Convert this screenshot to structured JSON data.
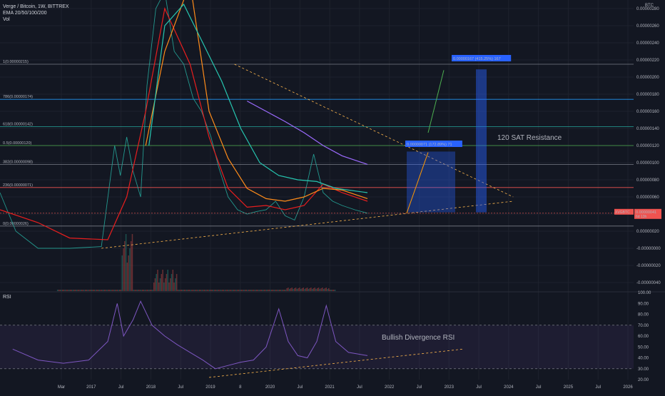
{
  "header": {
    "title": "Verge / Bitcoin, 1W, BITTREX",
    "indicator": "EMA 20/50/100/200",
    "volume": "Vol"
  },
  "price_unit": "BTC",
  "colors": {
    "background": "#131722",
    "grid": "#1e222d",
    "up": "#26a69a",
    "down": "#ef5350",
    "ema20": "#e91e1e",
    "ema50": "#ff8c1a",
    "ema100": "#26c6b0",
    "ema200": "#9c6bff",
    "rsi": "#7e57c2",
    "accent_blue": "#2962ff"
  },
  "chart_data": [
    {
      "type": "line",
      "title": "Verge / Bitcoin, 1W, BITTREX",
      "xlabel": "",
      "ylabel": "",
      "x_ticks": [
        "Mar",
        "2017",
        "Jul",
        "2018",
        "Jul",
        "2019",
        "8",
        "2020",
        "Jul",
        "2021",
        "Jul",
        "2022",
        "Jul",
        "2023",
        "Jul",
        "2024",
        "Jul",
        "2025",
        "Jul",
        "2026"
      ],
      "y_ticks": [
        "0.00000280",
        "0.00000260",
        "0.00000240",
        "0.00000220",
        "0.00000200",
        "0.00000180",
        "0.00000160",
        "0.00000140",
        "0.00000120",
        "0.00000100",
        "0.00000080",
        "0.00000060",
        "0.00000040",
        "0.00000020",
        "-0.00000000",
        "-0.00000020",
        "-0.00000040"
      ],
      "ylim": [
        -5e-07,
        2.9e-06
      ],
      "price_tag": {
        "symbol": "XVGBTC",
        "value": "0.00000041",
        "countdown": "6d 13h"
      },
      "fib_levels": [
        {
          "ratio": "1",
          "label": "1(0.00000215)",
          "price": 2.15e-06
        },
        {
          "ratio": "0.786",
          "label": "786(0.00000174)",
          "price": 1.74e-06
        },
        {
          "ratio": "0.618",
          "label": "618(0.00000142)",
          "price": 1.42e-06
        },
        {
          "ratio": "0.5",
          "label": "0.5(0.00000120)",
          "price": 1.2e-06
        },
        {
          "ratio": "0.382",
          "label": "382(0.00000098)",
          "price": 9.8e-07
        },
        {
          "ratio": "0.236",
          "label": "236(0.00000071)",
          "price": 7.1e-07
        },
        {
          "ratio": "0",
          "label": "0(0.00000026)",
          "price": 2.6e-07
        }
      ],
      "annotations": [
        {
          "text": "0.00000071 (172.89%) 71",
          "kind": "measure-label"
        },
        {
          "text": "0.00000167 (415.25%) 167",
          "kind": "measure-label"
        },
        {
          "text": "120 SAT Resistance",
          "kind": "note"
        }
      ],
      "series": [
        {
          "name": "Price",
          "x": [
            0.0,
            0.025,
            0.06,
            0.11,
            0.16,
            0.181,
            0.19,
            0.2,
            0.21,
            0.222,
            0.232,
            0.246,
            0.26,
            0.275,
            0.29,
            0.305,
            0.318,
            0.333,
            0.345,
            0.36,
            0.375,
            0.39,
            0.405,
            0.42,
            0.435,
            0.45,
            0.465,
            0.48,
            0.495,
            0.51,
            0.525,
            0.54,
            0.56,
            0.58
          ],
          "y": [
            6.5e-07,
            2e-07,
            0.0,
            0.0,
            2e-08,
            1.2e-06,
            8.5e-07,
            1.3e-06,
            9e-07,
            6e-07,
            1.9e-06,
            2.8e-06,
            3e-06,
            2.3e-06,
            2.15e-06,
            1.75e-06,
            1.6e-06,
            1.3e-06,
            9.5e-07,
            6e-07,
            4.5e-07,
            4e-07,
            4.3e-07,
            4.5e-07,
            5.5e-07,
            3.8e-07,
            3.3e-07,
            6e-07,
            1.1e-06,
            6.5e-07,
            5.5e-07,
            5e-07,
            4.5e-07,
            4.1e-07
          ]
        },
        {
          "name": "EMA 20",
          "x": [
            0.0,
            0.06,
            0.11,
            0.17,
            0.2,
            0.23,
            0.26,
            0.3,
            0.33,
            0.36,
            0.39,
            0.42,
            0.45,
            0.48,
            0.51,
            0.54,
            0.58
          ],
          "y": [
            4.5e-07,
            3e-07,
            1.2e-07,
            1e-07,
            6e-07,
            1.6e-06,
            2.8e-06,
            2.15e-06,
            1.3e-06,
            7e-07,
            4.8e-07,
            5e-07,
            4.5e-07,
            5e-07,
            7.5e-07,
            6.5e-07,
            5.5e-07
          ]
        },
        {
          "name": "EMA 50",
          "x": [
            0.23,
            0.26,
            0.3,
            0.33,
            0.36,
            0.39,
            0.42,
            0.45,
            0.48,
            0.51,
            0.54,
            0.58
          ],
          "y": [
            1.2e-06,
            2.3e-06,
            3.1e-06,
            1.6e-06,
            1.05e-06,
            7e-07,
            5.8e-07,
            5.5e-07,
            6e-07,
            7e-07,
            6.8e-07,
            5.8e-07
          ]
        },
        {
          "name": "EMA 100",
          "x": [
            0.235,
            0.26,
            0.29,
            0.32,
            0.35,
            0.38,
            0.41,
            0.44,
            0.47,
            0.5,
            0.53,
            0.58
          ],
          "y": [
            1.2e-06,
            2.6e-06,
            2.85e-06,
            2.4e-06,
            1.95e-06,
            1.4e-06,
            1e-06,
            8.5e-07,
            8e-07,
            7.8e-07,
            7e-07,
            6.5e-07
          ]
        },
        {
          "name": "EMA 200",
          "x": [
            0.39,
            0.42,
            0.45,
            0.48,
            0.51,
            0.54,
            0.58
          ],
          "y": [
            1.72e-06,
            1.6e-06,
            1.48e-06,
            1.35e-06,
            1.2e-06,
            1.08e-06,
            9.8e-07
          ]
        }
      ]
    },
    {
      "type": "line",
      "title": "RSI",
      "ylim": [
        20,
        100
      ],
      "y_ticks": [
        "100.00",
        "90.00",
        "80.00",
        "70.00",
        "60.00",
        "50.00",
        "40.00",
        "30.00",
        "20.00"
      ],
      "bands": {
        "upper": 70,
        "lower": 30
      },
      "annotations": [
        {
          "text": "Bullish Divergence RSI",
          "kind": "note"
        }
      ],
      "series": [
        {
          "name": "RSI",
          "x": [
            0.02,
            0.06,
            0.1,
            0.14,
            0.17,
            0.185,
            0.195,
            0.21,
            0.222,
            0.24,
            0.26,
            0.28,
            0.3,
            0.32,
            0.34,
            0.36,
            0.38,
            0.4,
            0.42,
            0.44,
            0.455,
            0.47,
            0.485,
            0.5,
            0.515,
            0.53,
            0.55,
            0.58
          ],
          "y": [
            48,
            38,
            35,
            38,
            55,
            90,
            60,
            75,
            92,
            70,
            60,
            52,
            45,
            38,
            30,
            33,
            36,
            38,
            50,
            85,
            55,
            42,
            40,
            55,
            88,
            55,
            45,
            42
          ]
        }
      ]
    }
  ]
}
